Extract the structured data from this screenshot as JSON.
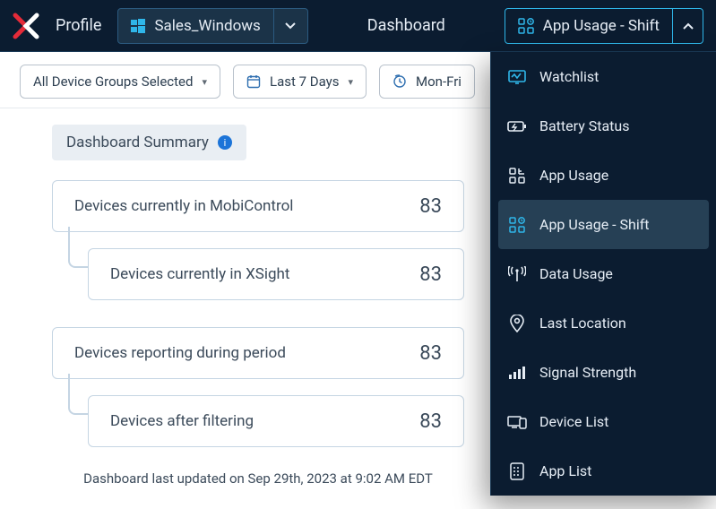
{
  "nav": {
    "profile_label": "Profile",
    "profile_value": "Sales_Windows",
    "dashboard_label": "Dashboard",
    "dashboard_value": "App Usage - Shift"
  },
  "filters": {
    "groups": "All Device Groups Selected",
    "range": "Last 7 Days",
    "schedule": "Mon-Fri"
  },
  "summary": {
    "title": "Dashboard Summary",
    "rows": [
      {
        "label": "Devices currently in MobiControl",
        "value": "83"
      },
      {
        "label": "Devices currently in XSight",
        "value": "83"
      },
      {
        "label": "Devices reporting during period",
        "value": "83"
      },
      {
        "label": "Devices after filtering",
        "value": "83"
      }
    ],
    "updated": "Dashboard last updated on Sep 29th, 2023 at 9:02 AM EDT"
  },
  "menu": {
    "items": [
      {
        "label": "Watchlist",
        "icon": "watchlist",
        "selected": false
      },
      {
        "label": "Battery Status",
        "icon": "battery",
        "selected": false
      },
      {
        "label": "App Usage",
        "icon": "appusage",
        "selected": false
      },
      {
        "label": "App Usage - Shift",
        "icon": "appshift",
        "selected": true
      },
      {
        "label": "Data Usage",
        "icon": "datausage",
        "selected": false
      },
      {
        "label": "Last Location",
        "icon": "location",
        "selected": false
      },
      {
        "label": "Signal Strength",
        "icon": "signal",
        "selected": false
      },
      {
        "label": "Device List",
        "icon": "devicelist",
        "selected": false
      },
      {
        "label": "App List",
        "icon": "applist",
        "selected": false
      }
    ]
  }
}
